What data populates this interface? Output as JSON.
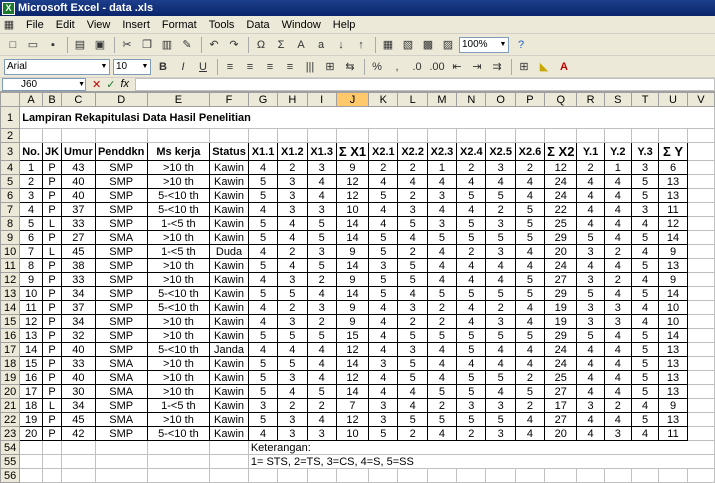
{
  "window": {
    "title": "Microsoft Excel - data        .xls"
  },
  "menu": [
    "File",
    "Edit",
    "View",
    "Insert",
    "Format",
    "Tools",
    "Data",
    "Window",
    "Help"
  ],
  "toolbar": {
    "zoom": "100%",
    "font": "Arial",
    "size": "10"
  },
  "formula": {
    "cell": "J60",
    "fx": "fx"
  },
  "columns": [
    "A",
    "B",
    "C",
    "D",
    "E",
    "F",
    "G",
    "H",
    "I",
    "J",
    "K",
    "L",
    "M",
    "N",
    "O",
    "P",
    "Q",
    "R",
    "S",
    "T",
    "U",
    "V"
  ],
  "title": "Lampiran Rekapitulasi Data Hasil Penelitian",
  "headers": [
    "No.",
    "JK",
    "Umur",
    "Penddkn",
    "Ms kerja",
    "Status",
    "X1.1",
    "X1.2",
    "X1.3",
    "Σ X1",
    "X2.1",
    "X2.2",
    "X2.3",
    "X2.4",
    "X2.5",
    "X2.6",
    "Σ X2",
    "Y.1",
    "Y.2",
    "Y.3",
    "Σ Y"
  ],
  "rows": [
    {
      "r": "4",
      "c": [
        "1",
        "P",
        "43",
        "SMP",
        ">10 th",
        "Kawin",
        "4",
        "2",
        "3",
        "9",
        "2",
        "2",
        "1",
        "2",
        "3",
        "2",
        "12",
        "2",
        "1",
        "3",
        "6"
      ]
    },
    {
      "r": "5",
      "c": [
        "2",
        "P",
        "40",
        "SMP",
        ">10 th",
        "Kawin",
        "5",
        "3",
        "4",
        "12",
        "4",
        "4",
        "4",
        "4",
        "4",
        "4",
        "24",
        "4",
        "4",
        "5",
        "13"
      ]
    },
    {
      "r": "6",
      "c": [
        "3",
        "P",
        "40",
        "SMP",
        "5-<10 th",
        "Kawin",
        "5",
        "3",
        "4",
        "12",
        "5",
        "2",
        "3",
        "5",
        "5",
        "4",
        "24",
        "4",
        "4",
        "5",
        "13"
      ]
    },
    {
      "r": "7",
      "c": [
        "4",
        "P",
        "37",
        "SMP",
        "5-<10 th",
        "Kawin",
        "4",
        "3",
        "3",
        "10",
        "4",
        "3",
        "4",
        "4",
        "2",
        "5",
        "22",
        "4",
        "4",
        "3",
        "11"
      ]
    },
    {
      "r": "8",
      "c": [
        "5",
        "L",
        "33",
        "SMP",
        "1-<5 th",
        "Kawin",
        "5",
        "4",
        "5",
        "14",
        "4",
        "5",
        "3",
        "5",
        "3",
        "5",
        "25",
        "4",
        "4",
        "4",
        "12"
      ]
    },
    {
      "r": "9",
      "c": [
        "6",
        "P",
        "27",
        "SMA",
        ">10 th",
        "Kawin",
        "5",
        "4",
        "5",
        "14",
        "5",
        "4",
        "5",
        "5",
        "5",
        "5",
        "29",
        "5",
        "4",
        "5",
        "14"
      ]
    },
    {
      "r": "10",
      "c": [
        "7",
        "L",
        "45",
        "SMP",
        "1-<5 th",
        "Duda",
        "4",
        "2",
        "3",
        "9",
        "5",
        "2",
        "4",
        "2",
        "3",
        "4",
        "20",
        "3",
        "2",
        "4",
        "9"
      ]
    },
    {
      "r": "11",
      "c": [
        "8",
        "P",
        "38",
        "SMP",
        ">10 th",
        "Kawin",
        "5",
        "4",
        "5",
        "14",
        "3",
        "5",
        "4",
        "4",
        "4",
        "4",
        "24",
        "4",
        "4",
        "5",
        "13"
      ]
    },
    {
      "r": "12",
      "c": [
        "9",
        "P",
        "33",
        "SMP",
        ">10 th",
        "Kawin",
        "4",
        "3",
        "2",
        "9",
        "5",
        "5",
        "4",
        "4",
        "4",
        "5",
        "27",
        "3",
        "2",
        "4",
        "9"
      ]
    },
    {
      "r": "13",
      "c": [
        "10",
        "P",
        "34",
        "SMP",
        "5-<10 th",
        "Kawin",
        "5",
        "5",
        "4",
        "14",
        "5",
        "4",
        "5",
        "5",
        "5",
        "5",
        "29",
        "5",
        "4",
        "5",
        "14"
      ]
    },
    {
      "r": "14",
      "c": [
        "11",
        "P",
        "37",
        "SMP",
        "5-<10 th",
        "Kawin",
        "4",
        "2",
        "3",
        "9",
        "4",
        "3",
        "2",
        "4",
        "2",
        "4",
        "19",
        "3",
        "3",
        "4",
        "10"
      ]
    },
    {
      "r": "15",
      "c": [
        "12",
        "P",
        "34",
        "SMP",
        ">10 th",
        "Kawin",
        "4",
        "3",
        "2",
        "9",
        "4",
        "2",
        "2",
        "4",
        "3",
        "4",
        "19",
        "3",
        "3",
        "4",
        "10"
      ]
    },
    {
      "r": "16",
      "c": [
        "13",
        "P",
        "32",
        "SMP",
        ">10 th",
        "Kawin",
        "5",
        "5",
        "5",
        "15",
        "4",
        "5",
        "5",
        "5",
        "5",
        "5",
        "29",
        "5",
        "4",
        "5",
        "14"
      ]
    },
    {
      "r": "17",
      "c": [
        "14",
        "P",
        "40",
        "SMP",
        "5-<10 th",
        "Janda",
        "4",
        "4",
        "4",
        "12",
        "4",
        "3",
        "4",
        "5",
        "4",
        "4",
        "24",
        "4",
        "4",
        "5",
        "13"
      ]
    },
    {
      "r": "18",
      "c": [
        "15",
        "P",
        "33",
        "SMA",
        ">10 th",
        "Kawin",
        "5",
        "5",
        "4",
        "14",
        "3",
        "5",
        "4",
        "4",
        "4",
        "4",
        "24",
        "4",
        "4",
        "5",
        "13"
      ]
    },
    {
      "r": "19",
      "c": [
        "16",
        "P",
        "40",
        "SMA",
        ">10 th",
        "Kawin",
        "5",
        "3",
        "4",
        "12",
        "4",
        "5",
        "4",
        "5",
        "5",
        "2",
        "25",
        "4",
        "4",
        "5",
        "13"
      ]
    },
    {
      "r": "20",
      "c": [
        "17",
        "P",
        "30",
        "SMA",
        ">10 th",
        "Kawin",
        "5",
        "4",
        "5",
        "14",
        "4",
        "4",
        "5",
        "5",
        "4",
        "5",
        "27",
        "4",
        "4",
        "5",
        "13"
      ]
    },
    {
      "r": "21",
      "c": [
        "18",
        "L",
        "34",
        "SMP",
        "1-<5 th",
        "Kawin",
        "3",
        "2",
        "2",
        "7",
        "3",
        "4",
        "2",
        "3",
        "3",
        "2",
        "17",
        "3",
        "2",
        "4",
        "9"
      ]
    },
    {
      "r": "22",
      "c": [
        "19",
        "P",
        "45",
        "SMA",
        ">10 th",
        "Kawin",
        "5",
        "3",
        "4",
        "12",
        "3",
        "5",
        "5",
        "5",
        "5",
        "4",
        "27",
        "4",
        "4",
        "5",
        "13"
      ]
    },
    {
      "r": "23",
      "c": [
        "20",
        "P",
        "42",
        "SMP",
        "5-<10 th",
        "Kawin",
        "4",
        "3",
        "3",
        "10",
        "5",
        "2",
        "4",
        "2",
        "3",
        "4",
        "20",
        "4",
        "3",
        "4",
        "11"
      ]
    }
  ],
  "notes": {
    "r54": "Keterangan:",
    "r55": "1= STS, 2=TS, 3=CS, 4=S, 5=SS"
  },
  "rowNums": {
    "title": "1",
    "blank": "2",
    "header": "3",
    "n54": "54",
    "n55": "55",
    "n56": "56"
  }
}
